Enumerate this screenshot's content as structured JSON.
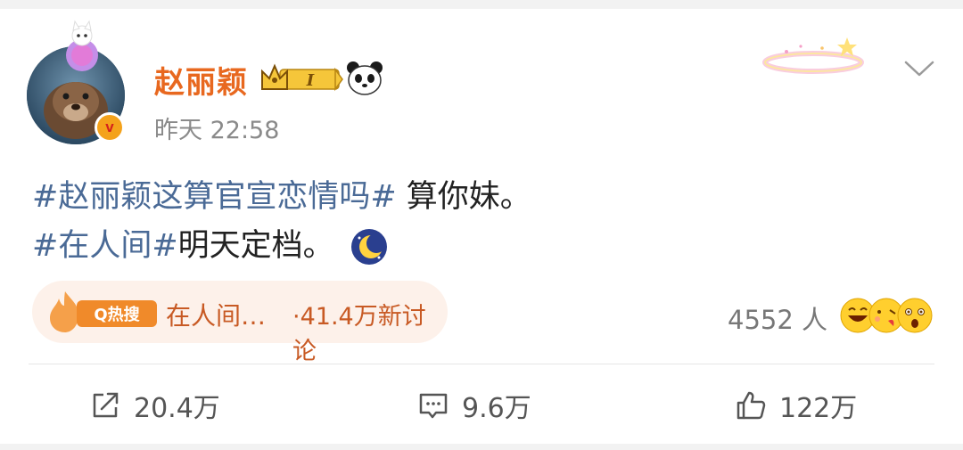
{
  "post": {
    "username": "赵丽颖",
    "vip_level": "I",
    "verified_mark": "v",
    "timestamp": "昨天 22:58",
    "line1_topic": "#赵丽颖这算官宣恋情吗#",
    "line1_text": " 算你妹。",
    "line2_topic": "#在人间#",
    "line2_text": "明天定档。",
    "emoji": "moon-emoji"
  },
  "hot_search": {
    "tag": "Q热搜",
    "topic": "在人间…",
    "discussion": "·41.4万新讨论"
  },
  "reactions": {
    "count": "4552 人",
    "emojis": [
      "laughing-emoji",
      "kissing-emoji",
      "surprised-emoji"
    ]
  },
  "actions": {
    "share": "20.4万",
    "comment": "9.6万",
    "like": "122万"
  },
  "colors": {
    "username": "#e8681f",
    "topic": "#4a6a96",
    "hot_text": "#c85a24",
    "hot_bg": "#fdf1ea"
  }
}
